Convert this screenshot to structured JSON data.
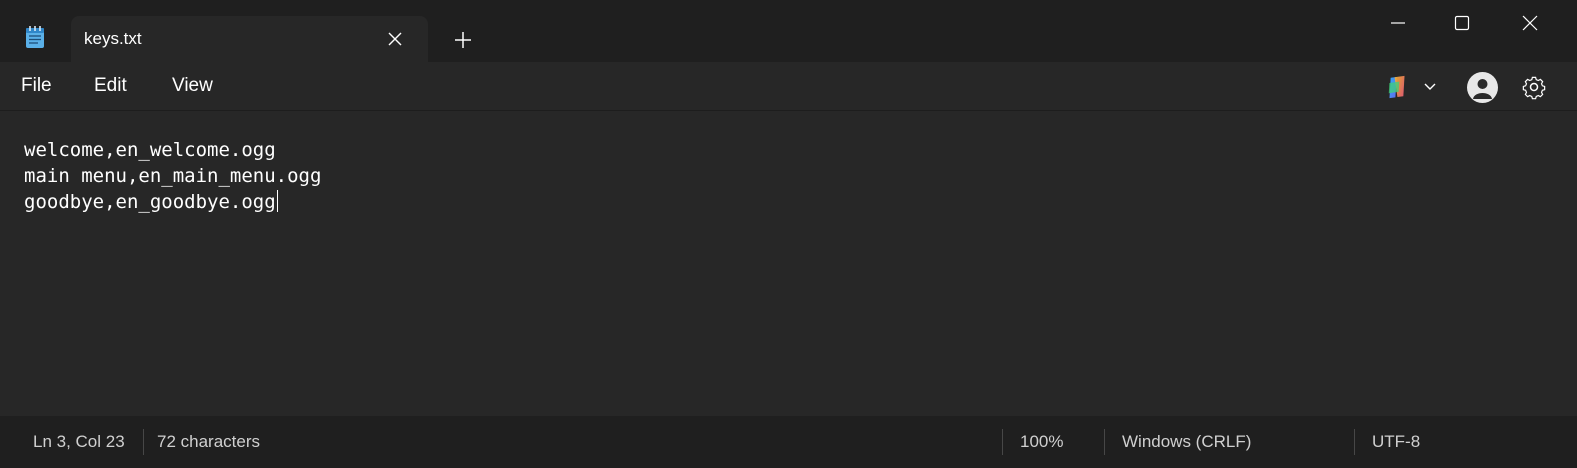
{
  "tab": {
    "title": "keys.txt"
  },
  "menu": {
    "file": "File",
    "edit": "Edit",
    "view": "View"
  },
  "editor": {
    "lines": [
      "welcome,en_welcome.ogg",
      "main menu,en_main_menu.ogg",
      "goodbye,en_goodbye.ogg"
    ]
  },
  "status": {
    "position": "Ln 3, Col 23",
    "characters": "72 characters",
    "zoom": "100%",
    "line_ending": "Windows (CRLF)",
    "encoding": "UTF-8"
  },
  "icons": {
    "app": "notepad-icon",
    "tab_close": "close-icon",
    "new_tab": "plus-icon",
    "minimize": "minimize-icon",
    "maximize": "maximize-icon",
    "close_window": "close-icon",
    "copilot": "copilot-icon",
    "dropdown": "chevron-down-icon",
    "account": "avatar",
    "settings": "gear-icon"
  },
  "colors": {
    "titlebar_bg": "#1f1f1f",
    "editor_bg": "#272727",
    "text": "#ffffff",
    "status_text": "#d0d0d0"
  }
}
